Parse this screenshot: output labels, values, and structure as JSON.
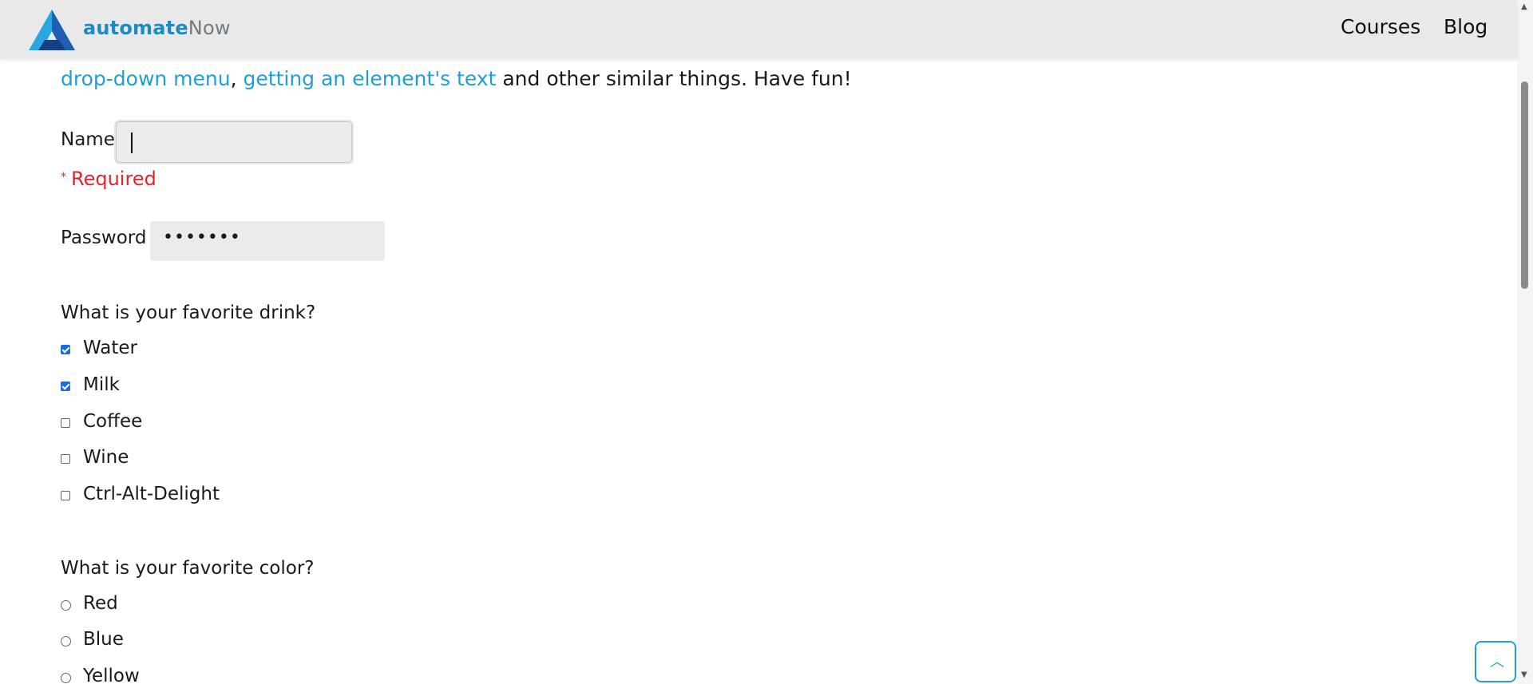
{
  "header": {
    "brand_part1": "automate",
    "brand_part2": "Now",
    "nav": [
      "Courses",
      "Blog"
    ]
  },
  "intro": {
    "link1": "drop-down menu",
    "sep": ",",
    "link2": "getting an element's text",
    "rest": "and other similar things. Have fun!"
  },
  "form": {
    "name_label": "Name",
    "name_value": "",
    "required_star": "*",
    "required_text": "Required",
    "password_label": "Password",
    "password_value": "•••••••",
    "drink_question": "What is your favorite drink?",
    "drinks": [
      {
        "label": "Water",
        "checked": true
      },
      {
        "label": "Milk",
        "checked": true
      },
      {
        "label": "Coffee",
        "checked": false
      },
      {
        "label": "Wine",
        "checked": false
      },
      {
        "label": "Ctrl-Alt-Delight",
        "checked": false
      }
    ],
    "color_question": "What is your favorite color?",
    "colors": [
      {
        "label": "Red",
        "checked": false
      },
      {
        "label": "Blue",
        "checked": false
      },
      {
        "label": "Yellow",
        "checked": false
      }
    ]
  },
  "colors": {
    "link": "#1f9fd6",
    "required": "#e0262b",
    "brand_blue": "#1f8ac0",
    "checkbox_checked": "#1a6fd6"
  },
  "icons": {
    "logo": "automatenow-logo",
    "back_to_top": "chevron-up-icon"
  }
}
